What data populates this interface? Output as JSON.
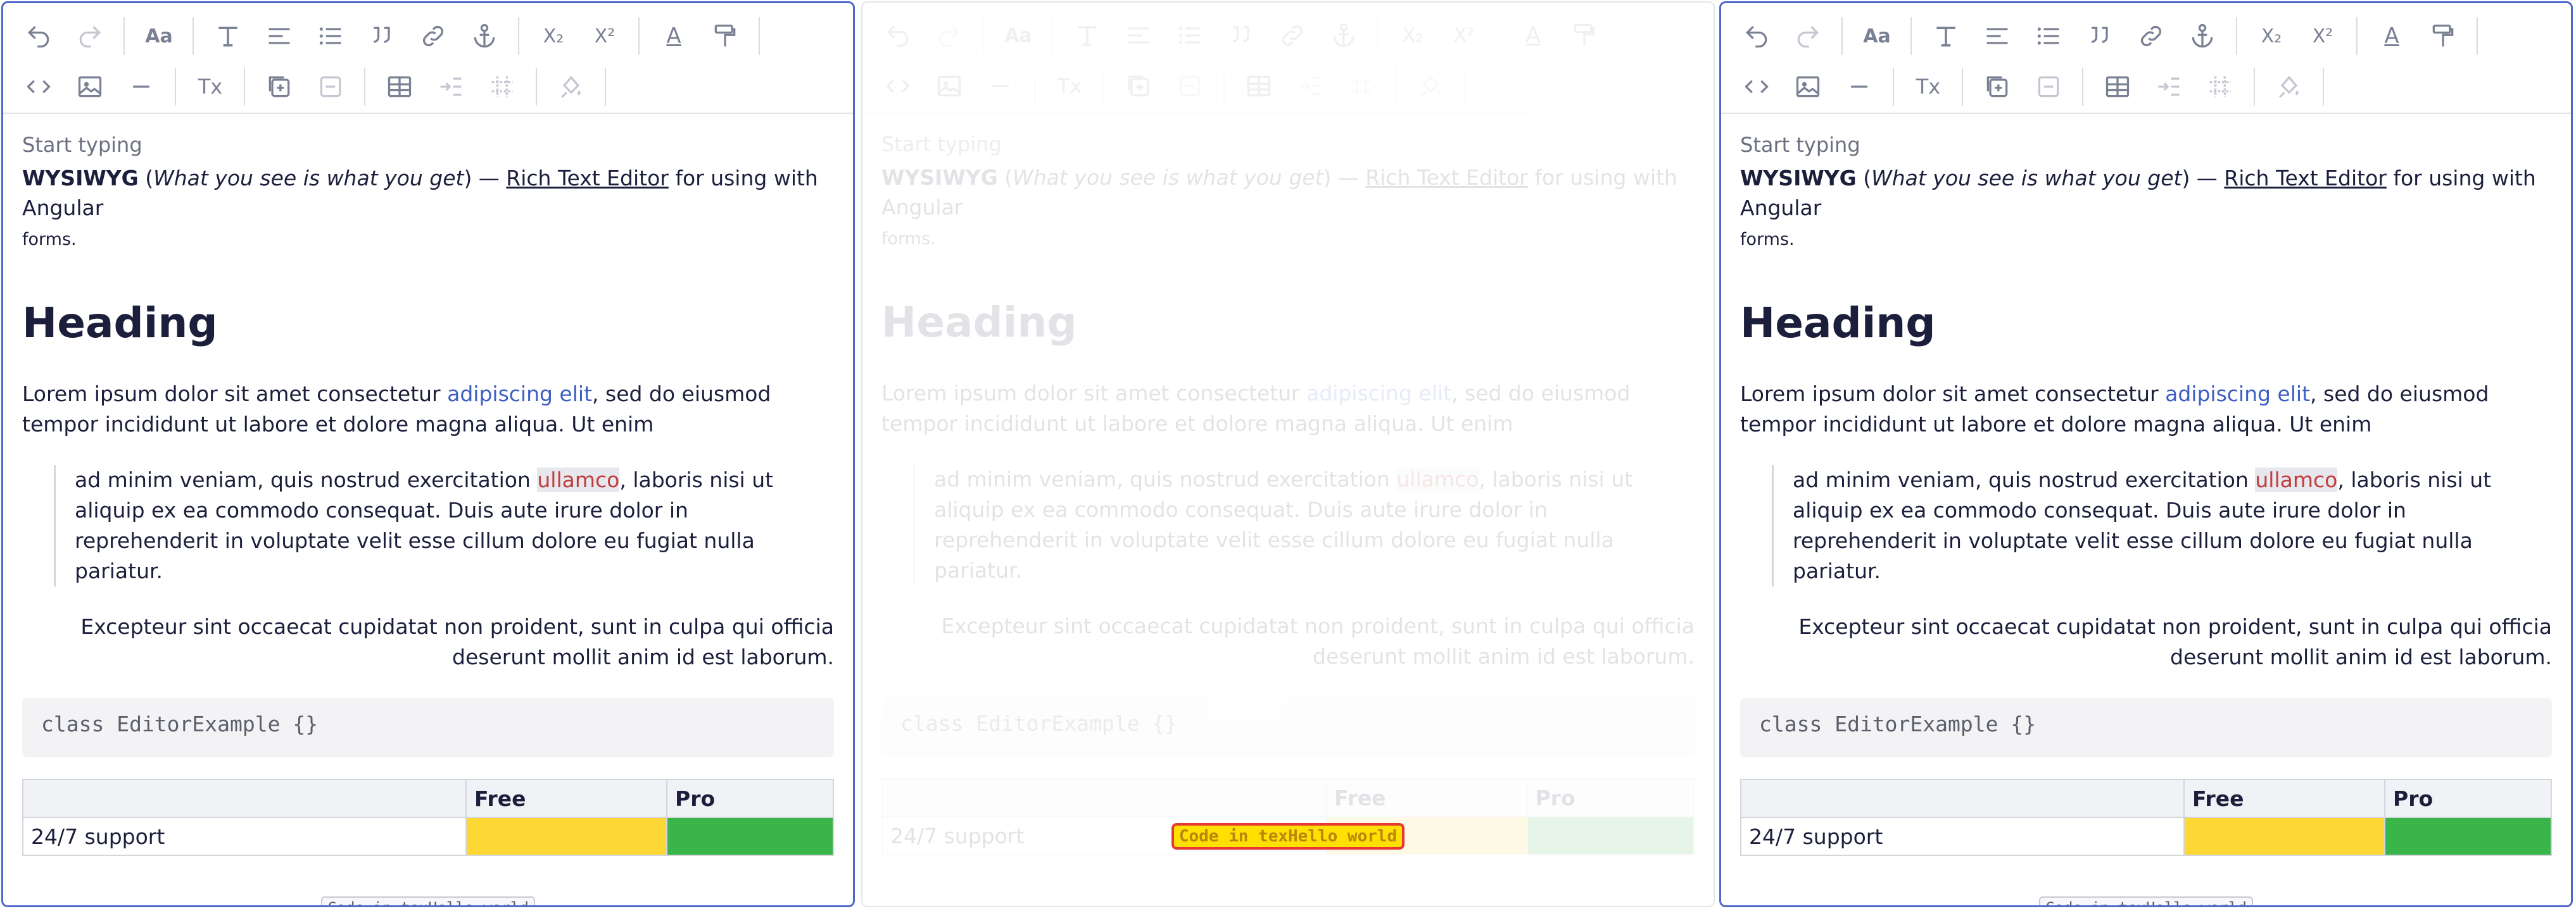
{
  "toolbar": {
    "row1": [
      "undo-icon",
      "redo-icon",
      "font-size-icon",
      "text-style-icon",
      "align-icon",
      "bullet-list-icon",
      "quote-icon",
      "link-icon",
      "anchor-icon",
      "subscript-icon",
      "superscript-icon",
      "text-color-icon",
      "format-painter-icon"
    ],
    "row2": [
      "code-icon",
      "image-icon",
      "horizontal-rule-icon",
      "clear-format-icon",
      "add-row-icon",
      "remove-row-icon",
      "table-icon",
      "table-merge-icon",
      "table-grid-icon",
      "fill-color-icon"
    ],
    "glyphs": {
      "font_size": "Aa",
      "subscript": "X₂",
      "superscript": "X²",
      "text_color": "A",
      "clear_format": "Tx"
    }
  },
  "content": {
    "placeholder": "Start typing",
    "intro_bold": "WYSIWYG",
    "intro_open": " (",
    "intro_italic": "What you see is what you get",
    "intro_close": ") — ",
    "intro_link": "Rich Text Editor",
    "intro_rest": " for using with Angular",
    "intro_forms": "forms.",
    "heading": "Heading",
    "para_start": "Lorem ipsum dolor sit amet consectetur ",
    "para_link": "adipiscing elit",
    "para_end": ", sed do eiusmod tempor incididunt ut labore et dolore magna aliqua. Ut enim",
    "quote_start": "ad minim veniam, quis nostrud exercitation ",
    "quote_hl": "ullamco",
    "quote_end": ", laboris nisi ut aliquip ex ea commodo consequat. Duis aute irure dolor in reprehenderit in voluptate velit esse cillum dolore eu fugiat nulla pariatur.",
    "right_para": "Excepteur sint occaecat cupidatat non proident, sunt in culpa qui officia deserunt mollit anim id est laborum.",
    "code_block": "class EditorExample {}",
    "table": {
      "headers": [
        "",
        "Free",
        "Pro"
      ],
      "row": [
        "24/7 support",
        "",
        ""
      ]
    },
    "inline_code": "Code in texHello world"
  },
  "colors": {
    "accent": "#4e69c9",
    "link": "#3d5fc4",
    "highlight_text": "#c23d3d",
    "cell_yellow": "#fdd835",
    "cell_green": "#3ab54a"
  }
}
